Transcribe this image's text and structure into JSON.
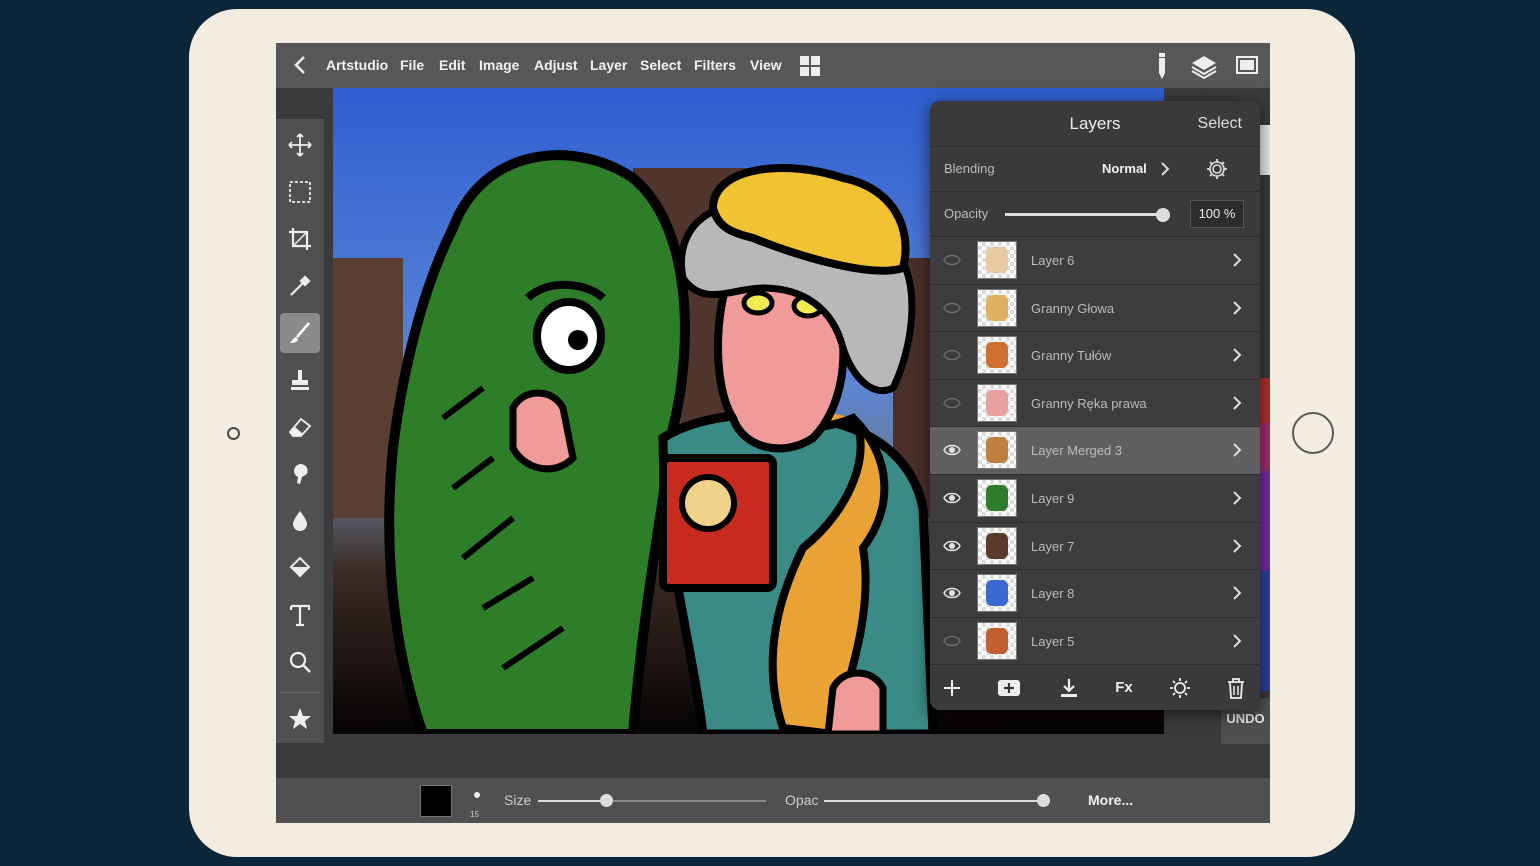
{
  "app": {
    "name": "Artstudio"
  },
  "menu": [
    "File",
    "Edit",
    "Image",
    "Adjust",
    "Layer",
    "Select",
    "Filters",
    "View"
  ],
  "icons": {
    "back": "chevron-left-icon",
    "grid": "grid-icon",
    "pencil": "pencil-icon",
    "layers": "layers-icon",
    "fullscreen": "fullscreen-icon"
  },
  "tools": [
    "move",
    "marquee",
    "crop",
    "eyedropper",
    "brush",
    "stamp",
    "eraser",
    "smudge",
    "blur",
    "fill",
    "text",
    "zoom",
    "favorites"
  ],
  "active_tool": "brush",
  "undo_label": "UNDO",
  "bottom": {
    "brush_size_number": "15",
    "size_label": "Size",
    "size_value": 0.3,
    "opac_label": "Opac",
    "opac_value": 1.0,
    "more_label": "More...",
    "color": "#000000"
  },
  "layers_panel": {
    "title": "Layers",
    "select_label": "Select",
    "blending_label": "Blending",
    "blending_value": "Normal",
    "opacity_label": "Opacity",
    "opacity_value": "100 %",
    "layers": [
      {
        "name": "Layer 6",
        "visible": false,
        "selected": false,
        "thumb": "#e8c9a0"
      },
      {
        "name": "Granny Głowa",
        "visible": false,
        "selected": false,
        "thumb": "#e0b060"
      },
      {
        "name": "Granny Tułów",
        "visible": false,
        "selected": false,
        "thumb": "#d07030"
      },
      {
        "name": "Granny Ręka prawa",
        "visible": false,
        "selected": false,
        "thumb": "#e8a0a0"
      },
      {
        "name": "Layer Merged 3",
        "visible": true,
        "selected": true,
        "thumb": "#c08040"
      },
      {
        "name": "Layer 9",
        "visible": true,
        "selected": false,
        "thumb": "#2f7d2a"
      },
      {
        "name": "Layer 7",
        "visible": true,
        "selected": false,
        "thumb": "#5a3a2a"
      },
      {
        "name": "Layer 8",
        "visible": true,
        "selected": false,
        "thumb": "#3a6ad0"
      },
      {
        "name": "Layer 5",
        "visible": false,
        "selected": false,
        "thumb": "#c06030"
      }
    ],
    "footer": [
      "add-layer-icon",
      "add-group-icon",
      "merge-down-icon",
      "fx-icon",
      "adjust-icon",
      "trash-icon"
    ],
    "fx_label": "Fx"
  },
  "colors": {
    "accent_sky": "#3e6fd4",
    "panel_bg": "#3a3a3c",
    "selected_row": "#5f5f61"
  }
}
